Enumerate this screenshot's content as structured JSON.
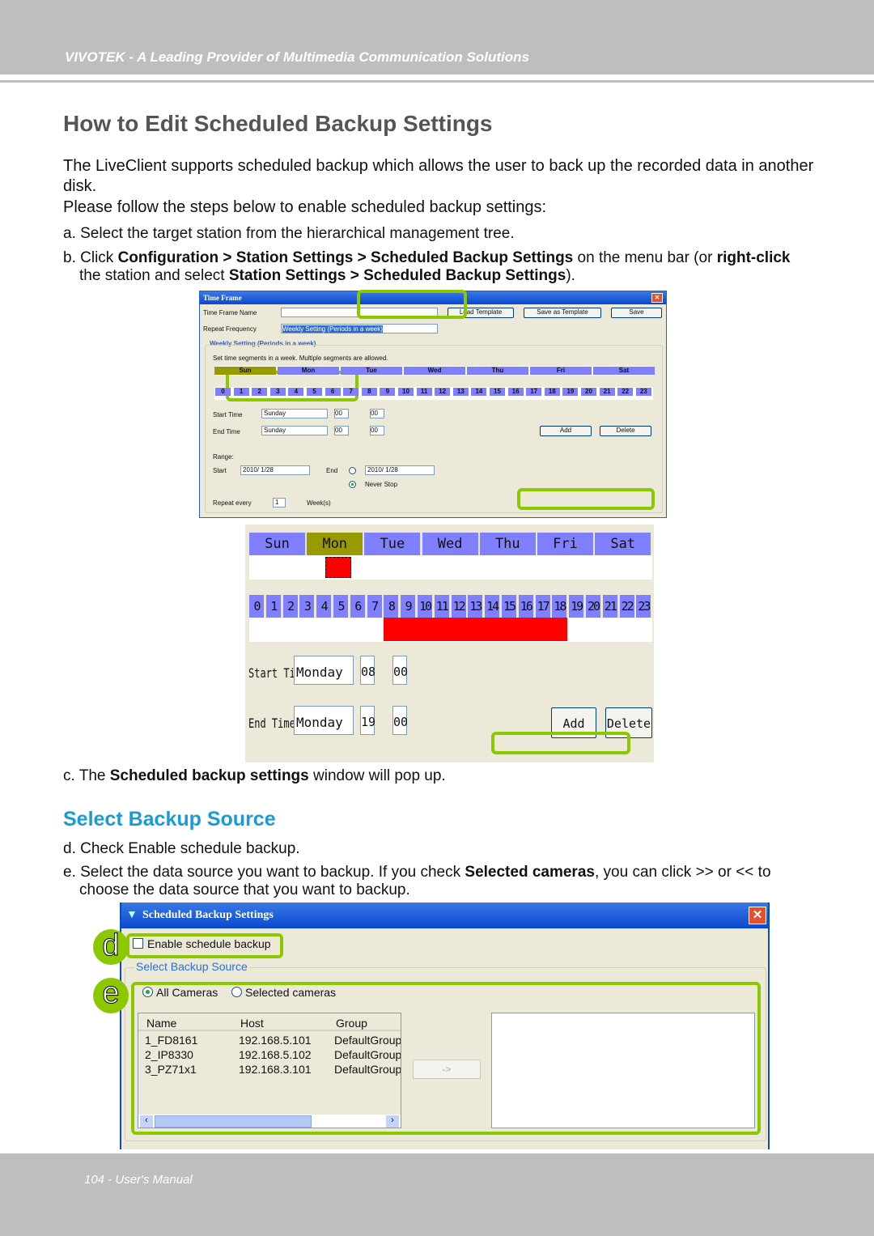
{
  "header": {
    "text": "VIVOTEK - A Leading Provider of Multimedia Communication Solutions"
  },
  "title": "How to Edit Scheduled Backup Settings",
  "intro": [
    "The LiveClient supports scheduled backup which allows the user to back up the recorded data in another disk.",
    "Please follow the steps below to enable scheduled backup settings:"
  ],
  "steps": {
    "a": "a. Select the target station from the hierarchical management tree.",
    "b": [
      {
        "t": "b. Click "
      },
      {
        "t": "Configuration > Station Settings > Scheduled Backup Settings",
        "b": true
      },
      {
        "t": " on the menu bar (or "
      },
      {
        "t": "right-click",
        "b": true
      },
      {
        "t": " the station and select "
      },
      {
        "t": "Station Settings > Scheduled Backup Settings",
        "b": true
      },
      {
        "t": ")."
      }
    ],
    "c": [
      {
        "t": "c. The "
      },
      {
        "t": "Scheduled backup settings",
        "b": true
      },
      {
        "t": " window will pop up."
      }
    ],
    "d": "d. Check Enable schedule backup.",
    "e": [
      {
        "t": "e. Select the data source you want to backup. If you check "
      },
      {
        "t": "Selected cameras",
        "b": true
      },
      {
        "t": ", you can click >> or << to choose the data source that you want to backup."
      }
    ]
  },
  "section": "Select Backup Source",
  "time_frame": {
    "title": "Time Frame",
    "name_label": "Time Frame Name",
    "name_value": "",
    "load": "Load Template",
    "save_as": "Save as Template",
    "save": "Save",
    "repeat_label": "Repeat Frequency",
    "repeat_value": "Weekly Setting (Periods in a week)",
    "group": "Weekly Setting (Periods in a week)",
    "hint": "Set time segments in a week. Multiple segments are allowed.",
    "days": [
      "Sun",
      "Mon",
      "Tue",
      "Wed",
      "Thu",
      "Fri",
      "Sat"
    ],
    "hours": [
      "0",
      "1",
      "2",
      "3",
      "4",
      "5",
      "6",
      "7",
      "8",
      "9",
      "10",
      "11",
      "12",
      "13",
      "14",
      "15",
      "16",
      "17",
      "18",
      "19",
      "20",
      "21",
      "22",
      "23"
    ],
    "start_label": "Start Time",
    "start_day": "Sunday",
    "start_h": "00",
    "start_m": "00",
    "end_label": "End Time",
    "end_day": "Sunday",
    "end_h": "00",
    "end_m": "00",
    "add": "Add",
    "delete": "Delete",
    "range": "Range:",
    "range_start": "Start",
    "start_date": "2010/ 1/28",
    "range_end": "End",
    "end_date": "2010/ 1/28",
    "never": "Never Stop",
    "repeat_every": "Repeat every",
    "repeat_n": "1",
    "weeks": "Week(s)"
  },
  "zoomed": {
    "start_day": "Monday",
    "start_h": "08",
    "start_m": "00",
    "end_day": "Monday",
    "end_h": "19",
    "end_m": "00",
    "selected_day": "Mon",
    "selected_hours": [
      8,
      18
    ],
    "selected_color": "#ff0000"
  },
  "backup": {
    "title": "Scheduled Backup Settings",
    "enable": "Enable schedule backup",
    "enabled": false,
    "group": "Select Backup Source",
    "all": "All Cameras",
    "selected": "Selected cameras",
    "mode": "all",
    "columns": [
      "Name",
      "Host",
      "Group"
    ],
    "rows": [
      [
        "1_FD8161",
        "192.168.5.101",
        "DefaultGroup"
      ],
      [
        "2_IP8330",
        "192.168.5.102",
        "DefaultGroup"
      ],
      [
        "3_PZ71x1",
        "192.168.3.101",
        "DefaultGroup"
      ]
    ],
    "arrow": "->",
    "marker_d": "d",
    "marker_e": "e"
  },
  "footer": "104 - User's Manual",
  "colors": {
    "accent": "#1a9ad6",
    "highlight": "#8cc800",
    "day_cell": "#8080ff",
    "selected_day": "#999900"
  }
}
